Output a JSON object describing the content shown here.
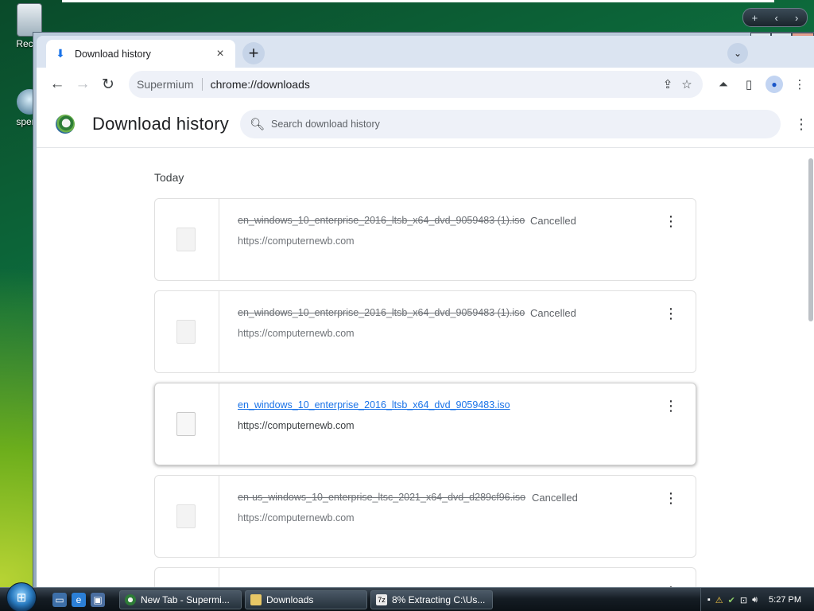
{
  "desktop": {
    "icons": [
      {
        "label": "Recyc",
        "icon": "recycle-bin-icon"
      },
      {
        "label": "sperm",
        "icon": "supermium-shortcut-icon"
      }
    ]
  },
  "browser": {
    "tab": {
      "title": "Download history",
      "icon": "download-icon",
      "close": "×"
    },
    "new_tab": "+",
    "tab_search": "⌄",
    "nav": {
      "back": "←",
      "forward": "→",
      "reload": "↻"
    },
    "omnibox": {
      "site": "Supermium",
      "url": "chrome://downloads"
    },
    "toolbar_icons": [
      "share-icon",
      "bookmark-star-icon",
      "labs-flask-icon",
      "side-panel-icon",
      "profile-icon",
      "menu-icon"
    ]
  },
  "downloads_page": {
    "title": "Download history",
    "search_placeholder": "Search download history",
    "date_header": "Today",
    "items": [
      {
        "filename": "en_windows_10_enterprise_2016_ltsb_x64_dvd_9059483 (1).iso",
        "status": "Cancelled",
        "url": "https://computernewb.com",
        "cancelled": true
      },
      {
        "filename": "en_windows_10_enterprise_2016_ltsb_x64_dvd_9059483 (1).iso",
        "status": "Cancelled",
        "url": "https://computernewb.com",
        "cancelled": true
      },
      {
        "filename": "en_windows_10_enterprise_2016_ltsb_x64_dvd_9059483.iso",
        "status": "",
        "url": "https://computernewb.com",
        "cancelled": false
      },
      {
        "filename": "en-us_windows_10_enterprise_ltsc_2021_x64_dvd_d289cf96.iso",
        "status": "Cancelled",
        "url": "https://computernewb.com",
        "cancelled": true
      }
    ]
  },
  "taskbar": {
    "tasks": [
      {
        "label": "New Tab - Supermi...",
        "icon": "supermium-icon"
      },
      {
        "label": "Downloads",
        "icon": "folder-icon"
      },
      {
        "label": "8% Extracting C:\\Us...",
        "icon": "7zip-icon"
      }
    ],
    "clock": "5:27 PM"
  }
}
